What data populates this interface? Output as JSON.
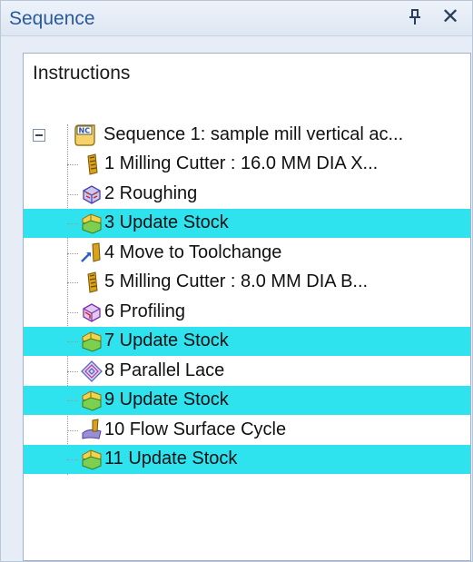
{
  "panel": {
    "title": "Sequence",
    "pin_glyph": "ᵖ",
    "close_glyph": "✕"
  },
  "tree": {
    "header": "Instructions",
    "root": {
      "label": "Sequence 1: sample mill vertical ac...",
      "icon": "nc-sequence-icon"
    },
    "items": [
      {
        "label": "1 Milling Cutter : 16.0 MM DIA X...",
        "icon": "milling-cutter-icon",
        "highlighted": false
      },
      {
        "label": "2 Roughing",
        "icon": "roughing-icon",
        "highlighted": false
      },
      {
        "label": "3 Update Stock",
        "icon": "update-stock-icon",
        "highlighted": true
      },
      {
        "label": "4 Move to Toolchange",
        "icon": "move-to-toolchange-icon",
        "highlighted": false
      },
      {
        "label": "5 Milling Cutter : 8.0 MM DIA B...",
        "icon": "milling-cutter-icon",
        "highlighted": false
      },
      {
        "label": "6 Profiling",
        "icon": "profiling-icon",
        "highlighted": false
      },
      {
        "label": "7 Update Stock",
        "icon": "update-stock-icon",
        "highlighted": true
      },
      {
        "label": "8 Parallel Lace",
        "icon": "parallel-lace-icon",
        "highlighted": false
      },
      {
        "label": "9 Update Stock",
        "icon": "update-stock-icon",
        "highlighted": true
      },
      {
        "label": "10 Flow Surface Cycle",
        "icon": "flow-surface-cycle-icon",
        "highlighted": false
      },
      {
        "label": "11 Update Stock",
        "icon": "update-stock-icon",
        "highlighted": true
      }
    ]
  },
  "colors": {
    "highlight": "#2ee2ee",
    "title_text": "#2a5a9c"
  }
}
